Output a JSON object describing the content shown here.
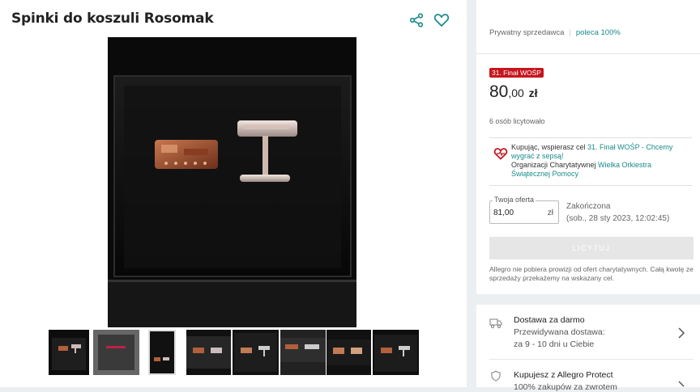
{
  "product": {
    "title": "Spinki do koszuli Rosomak"
  },
  "icons": {
    "share": "share-icon",
    "favorite": "heart-icon",
    "charity": "heart-charity-icon",
    "delivery": "truck-icon",
    "protect": "shield-icon",
    "chevron": "chevron-right-icon"
  },
  "seller": {
    "type": "Prywatny sprzedawca",
    "recommend": "poleca 100%"
  },
  "badge": {
    "label": "31. Finał WOŚP"
  },
  "price": {
    "main": "80",
    "decimals": ",00",
    "currency": "zł"
  },
  "bids": {
    "text": "6 osób licytowało"
  },
  "charity": {
    "prefix": "Kupując, wspierasz cel ",
    "cause": "31. Finał WOŚP - Chcemy wygrać z sepsą!",
    "org_prefix": "Organizacji Charytatywnej ",
    "org": "Wielka Orkiestra Świątecznej Pomocy"
  },
  "offer": {
    "label": "Twoja oferta",
    "value": "81,00",
    "currency": "zł"
  },
  "status": {
    "ended": "Zakończona",
    "date": "(sob., 28 sty 2023, 12:02:45)"
  },
  "bid_button": {
    "label": "LICYTUJ"
  },
  "note": {
    "text": "Allegro nie pobiera prowizji od ofert charytatywnych. Całą kwotę ze sprzedaży przekażemy na wskazany cel."
  },
  "delivery": {
    "title": "Dostawa za darmo",
    "line2": "Przewidywana dostawa:",
    "line3": "za 9 - 10 dni u Ciebie"
  },
  "protect": {
    "title": "Kupujesz z Allegro Protect",
    "subtitle": "100% zakupów za zwrotem"
  },
  "colors": {
    "accent_teal": "#1a8a8a",
    "badge_red": "#c7151e",
    "heart_outline": "#1a8a8a"
  }
}
